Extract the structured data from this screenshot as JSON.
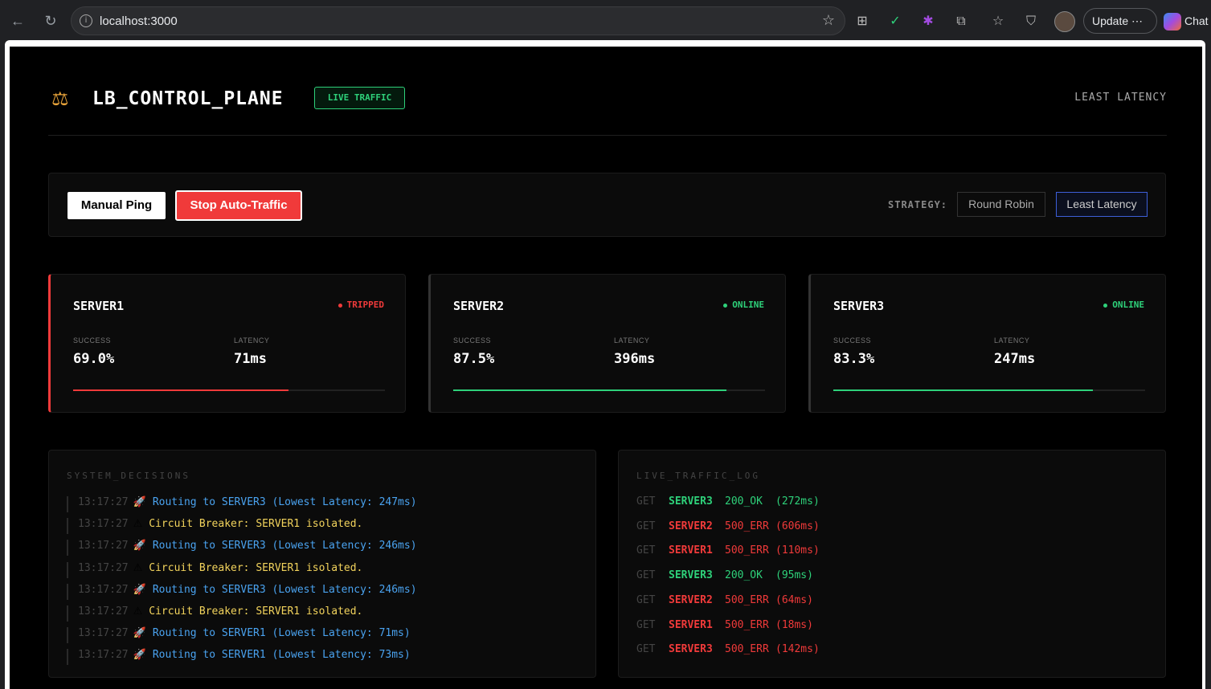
{
  "browser": {
    "url": "localhost:3000",
    "update_label": "Update",
    "chat_label": "Chat"
  },
  "header": {
    "title": "LB_CONTROL_PLANE",
    "badge": "LIVE TRAFFIC",
    "current_strategy": "LEAST LATENCY"
  },
  "controls": {
    "manual_ping": "Manual Ping",
    "stop_auto": "Stop Auto-Traffic",
    "strategy_label": "STRATEGY:",
    "strategies": [
      "Round Robin",
      "Least Latency"
    ],
    "active_strategy": "Least Latency"
  },
  "servers": [
    {
      "name": "SERVER1",
      "status": "TRIPPED",
      "success_label": "SUCCESS",
      "success": "69.0%",
      "success_fraction": 0.69,
      "latency_label": "LATENCY",
      "latency": "71ms",
      "color": "#f03a3a"
    },
    {
      "name": "SERVER2",
      "status": "ONLINE",
      "success_label": "SUCCESS",
      "success": "87.5%",
      "success_fraction": 0.875,
      "latency_label": "LATENCY",
      "latency": "396ms",
      "color": "#2ed17a"
    },
    {
      "name": "SERVER3",
      "status": "ONLINE",
      "success_label": "SUCCESS",
      "success": "83.3%",
      "success_fraction": 0.833,
      "latency_label": "LATENCY",
      "latency": "247ms",
      "color": "#2ed17a"
    }
  ],
  "decisions": {
    "title": "SYSTEM_DECISIONS",
    "items": [
      {
        "time": "13:17:27",
        "type": "info",
        "icon": "🚀",
        "text": "Routing to SERVER3 (Lowest Latency: 247ms)"
      },
      {
        "time": "13:17:27",
        "type": "warn",
        "icon": "⚠",
        "text": "Circuit Breaker: SERVER1 isolated."
      },
      {
        "time": "13:17:27",
        "type": "info",
        "icon": "🚀",
        "text": "Routing to SERVER3 (Lowest Latency: 246ms)"
      },
      {
        "time": "13:17:27",
        "type": "warn",
        "icon": "⚠",
        "text": "Circuit Breaker: SERVER1 isolated."
      },
      {
        "time": "13:17:27",
        "type": "info",
        "icon": "🚀",
        "text": "Routing to SERVER3 (Lowest Latency: 246ms)"
      },
      {
        "time": "13:17:27",
        "type": "warn",
        "icon": "⚠",
        "text": "Circuit Breaker: SERVER1 isolated."
      },
      {
        "time": "13:17:27",
        "type": "info",
        "icon": "🚀",
        "text": "Routing to SERVER1 (Lowest Latency: 71ms)"
      },
      {
        "time": "13:17:27",
        "type": "info",
        "icon": "🚀",
        "text": "Routing to SERVER1 (Lowest Latency: 73ms)"
      }
    ]
  },
  "traffic": {
    "title": "LIVE_TRAFFIC_LOG",
    "items": [
      {
        "method": "GET",
        "server": "SERVER3",
        "code": "200_OK",
        "time": "(272ms)",
        "ok": true
      },
      {
        "method": "GET",
        "server": "SERVER2",
        "code": "500_ERR",
        "time": "(606ms)",
        "ok": false
      },
      {
        "method": "GET",
        "server": "SERVER1",
        "code": "500_ERR",
        "time": "(110ms)",
        "ok": false
      },
      {
        "method": "GET",
        "server": "SERVER3",
        "code": "200_OK",
        "time": "(95ms)",
        "ok": true
      },
      {
        "method": "GET",
        "server": "SERVER2",
        "code": "500_ERR",
        "time": "(64ms)",
        "ok": false
      },
      {
        "method": "GET",
        "server": "SERVER1",
        "code": "500_ERR",
        "time": "(18ms)",
        "ok": false
      },
      {
        "method": "GET",
        "server": "SERVER3",
        "code": "500_ERR",
        "time": "(142ms)",
        "ok": false
      }
    ]
  }
}
